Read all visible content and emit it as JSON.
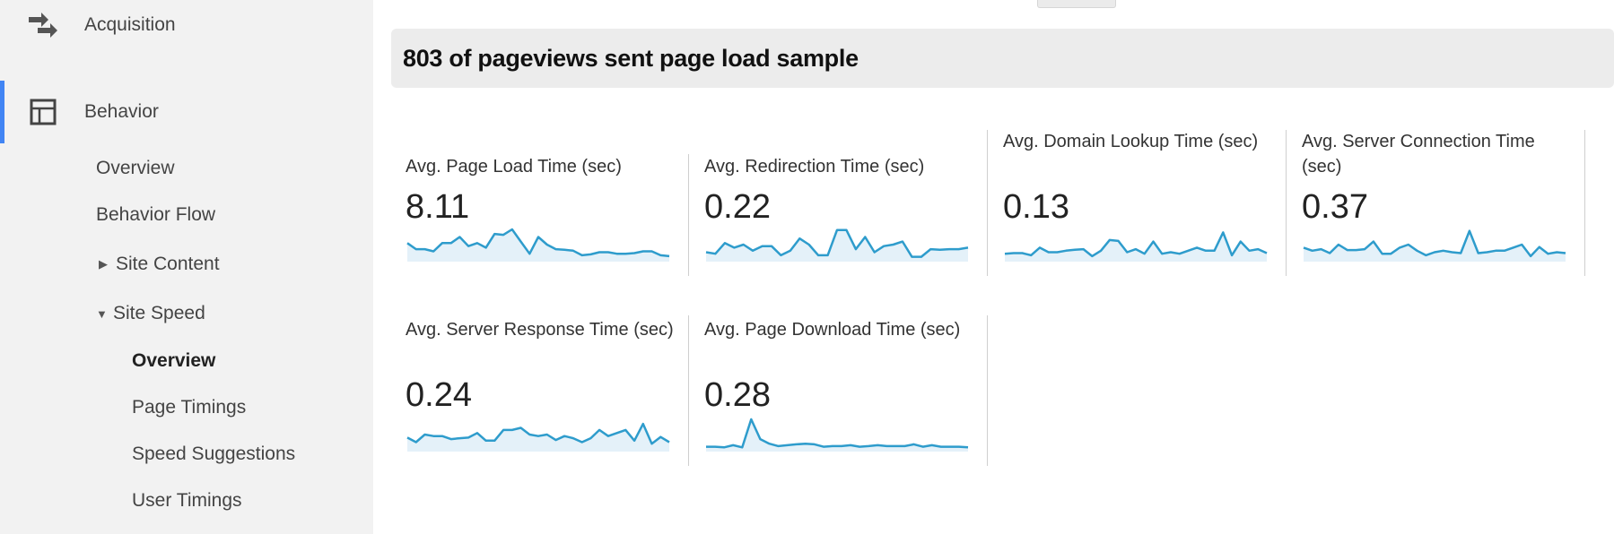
{
  "sidebar": {
    "top_items": [
      {
        "label": "Acquisition",
        "icon": "acquisition-arrows-icon"
      },
      {
        "label": "Behavior",
        "icon": "behavior-layout-icon",
        "active": true
      }
    ],
    "behavior_children": [
      {
        "label": "Overview"
      },
      {
        "label": "Behavior Flow"
      },
      {
        "label": "Site Content",
        "caret": "▶",
        "expanded": false
      },
      {
        "label": "Site Speed",
        "caret": "▼",
        "expanded": true
      }
    ],
    "site_speed_children": [
      {
        "label": "Overview",
        "selected": true
      },
      {
        "label": "Page Timings"
      },
      {
        "label": "Speed Suggestions"
      },
      {
        "label": "User Timings"
      }
    ],
    "accent_color": "#4285f4"
  },
  "banner": {
    "title": "803 of pageviews sent page load sample"
  },
  "metrics": [
    {
      "label": "Avg. Page Load Time (sec)",
      "value": "8.11",
      "spark": [
        0.55,
        0.35,
        0.35,
        0.28,
        0.55,
        0.55,
        0.75,
        0.45,
        0.55,
        0.4,
        0.85,
        0.82,
        1.0,
        0.6,
        0.2,
        0.75,
        0.5,
        0.35,
        0.33,
        0.3,
        0.15,
        0.18,
        0.25,
        0.25,
        0.2,
        0.2,
        0.22,
        0.28,
        0.28,
        0.15,
        0.12
      ]
    },
    {
      "label": "Avg. Redirection Time (sec)",
      "value": "0.22",
      "spark": [
        0.25,
        0.2,
        0.55,
        0.4,
        0.5,
        0.3,
        0.45,
        0.45,
        0.15,
        0.3,
        0.7,
        0.5,
        0.15,
        0.15,
        0.98,
        0.98,
        0.35,
        0.75,
        0.25,
        0.45,
        0.5,
        0.6,
        0.1,
        0.1,
        0.35,
        0.33,
        0.35,
        0.35,
        0.4
      ]
    },
    {
      "label": "Avg. Domain Lookup Time (sec)",
      "value": "0.13",
      "spark": [
        0.2,
        0.22,
        0.22,
        0.15,
        0.4,
        0.25,
        0.25,
        0.3,
        0.33,
        0.35,
        0.12,
        0.3,
        0.65,
        0.62,
        0.25,
        0.35,
        0.2,
        0.6,
        0.2,
        0.25,
        0.2,
        0.3,
        0.4,
        0.3,
        0.3,
        0.9,
        0.15,
        0.6,
        0.3,
        0.35,
        0.22
      ]
    },
    {
      "label": "Avg. Server Connection Time (sec)",
      "value": "0.37",
      "spark": [
        0.4,
        0.3,
        0.35,
        0.22,
        0.5,
        0.32,
        0.32,
        0.35,
        0.6,
        0.2,
        0.2,
        0.4,
        0.5,
        0.3,
        0.15,
        0.25,
        0.3,
        0.25,
        0.22,
        0.95,
        0.22,
        0.25,
        0.3,
        0.3,
        0.4,
        0.5,
        0.12,
        0.42,
        0.2,
        0.25,
        0.22
      ]
    },
    {
      "label": "Avg. Server Response Time (sec)",
      "value": "0.24",
      "spark": [
        0.4,
        0.25,
        0.5,
        0.45,
        0.45,
        0.35,
        0.38,
        0.4,
        0.55,
        0.3,
        0.3,
        0.65,
        0.65,
        0.72,
        0.5,
        0.45,
        0.5,
        0.32,
        0.45,
        0.38,
        0.25,
        0.38,
        0.65,
        0.45,
        0.55,
        0.65,
        0.3,
        0.85,
        0.2,
        0.42,
        0.25
      ]
    },
    {
      "label": "Avg. Page Download Time (sec)",
      "value": "0.28",
      "spark": [
        0.1,
        0.1,
        0.08,
        0.15,
        0.08,
        1.0,
        0.35,
        0.2,
        0.12,
        0.15,
        0.18,
        0.2,
        0.18,
        0.1,
        0.12,
        0.12,
        0.15,
        0.1,
        0.12,
        0.15,
        0.12,
        0.12,
        0.12,
        0.18,
        0.1,
        0.15,
        0.1,
        0.1,
        0.1,
        0.08
      ]
    }
  ],
  "colors": {
    "spark_line": "#2e9ccc",
    "spark_fill": "#e4f1f9"
  }
}
